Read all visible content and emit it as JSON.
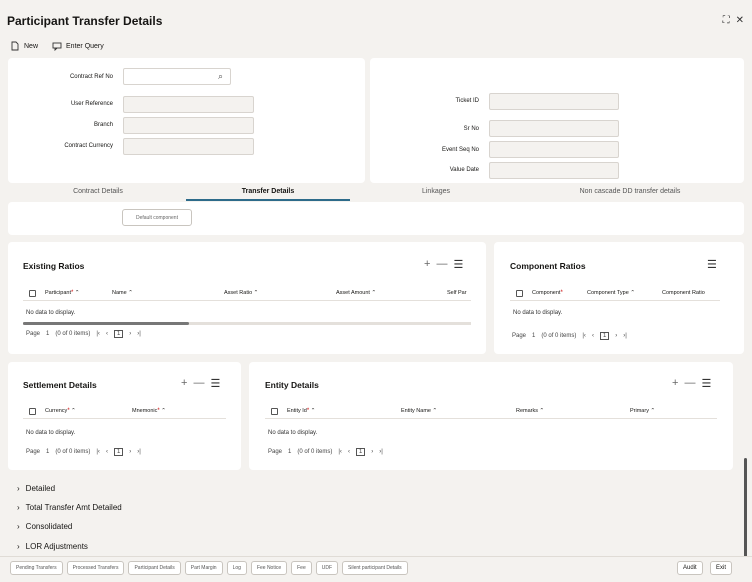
{
  "page": {
    "title": "Participant Transfer Details"
  },
  "toolbar": {
    "new_label": "New",
    "enter_query_label": "Enter Query"
  },
  "form": {
    "contract_ref_no": "Contract Ref No",
    "user_reference": "User Reference",
    "branch": "Branch",
    "contract_currency": "Contract Currency",
    "ticket_id": "Ticket ID",
    "sr_no": "Sr No",
    "event_seq_no": "Event Seq No",
    "value_date": "Value Date"
  },
  "tabs": [
    "Contract Details",
    "Transfer Details",
    "Linkages",
    "Non cascade DD transfer details"
  ],
  "default_component": "Default component",
  "existing_ratios": {
    "title": "Existing Ratios",
    "cols": [
      "Participant",
      "Name",
      "Asset Ratio",
      "Asset Amount",
      "Self Par"
    ],
    "nodata": "No data to display.",
    "page": "Page",
    "pagenum": "1",
    "items": "(0 of 0 items)",
    "cur": "1"
  },
  "component_ratios": {
    "title": "Component Ratios",
    "cols": [
      "Component",
      "Component Type",
      "Component Ratio"
    ],
    "nodata": "No data to display.",
    "page": "Page",
    "pagenum": "1",
    "items": "(0 of 0 items)",
    "cur": "1"
  },
  "settlement": {
    "title": "Settlement Details",
    "cols": [
      "Currency",
      "Mnemonic"
    ],
    "nodata": "No data to display.",
    "page": "Page",
    "pagenum": "1",
    "items": "(0 of 0 items)",
    "cur": "1"
  },
  "entity": {
    "title": "Entity Details",
    "cols": [
      "Entity Id",
      "Entity Name",
      "Remarks",
      "Primary"
    ],
    "nodata": "No data to display.",
    "page": "Page",
    "pagenum": "1",
    "items": "(0 of 0 items)",
    "cur": "1"
  },
  "accordions": [
    "Detailed",
    "Total Transfer Amt Detailed",
    "Consolidated",
    "LOR Adjustments"
  ],
  "footer": {
    "buttons": [
      "Pending Transfers",
      "Processed Transfers",
      "Participant Details",
      "Part Margin",
      "Log",
      "Fee Notice",
      "Fee",
      "UDF",
      "Silent participant Details"
    ],
    "audit": "Audit",
    "exit": "Exit"
  }
}
